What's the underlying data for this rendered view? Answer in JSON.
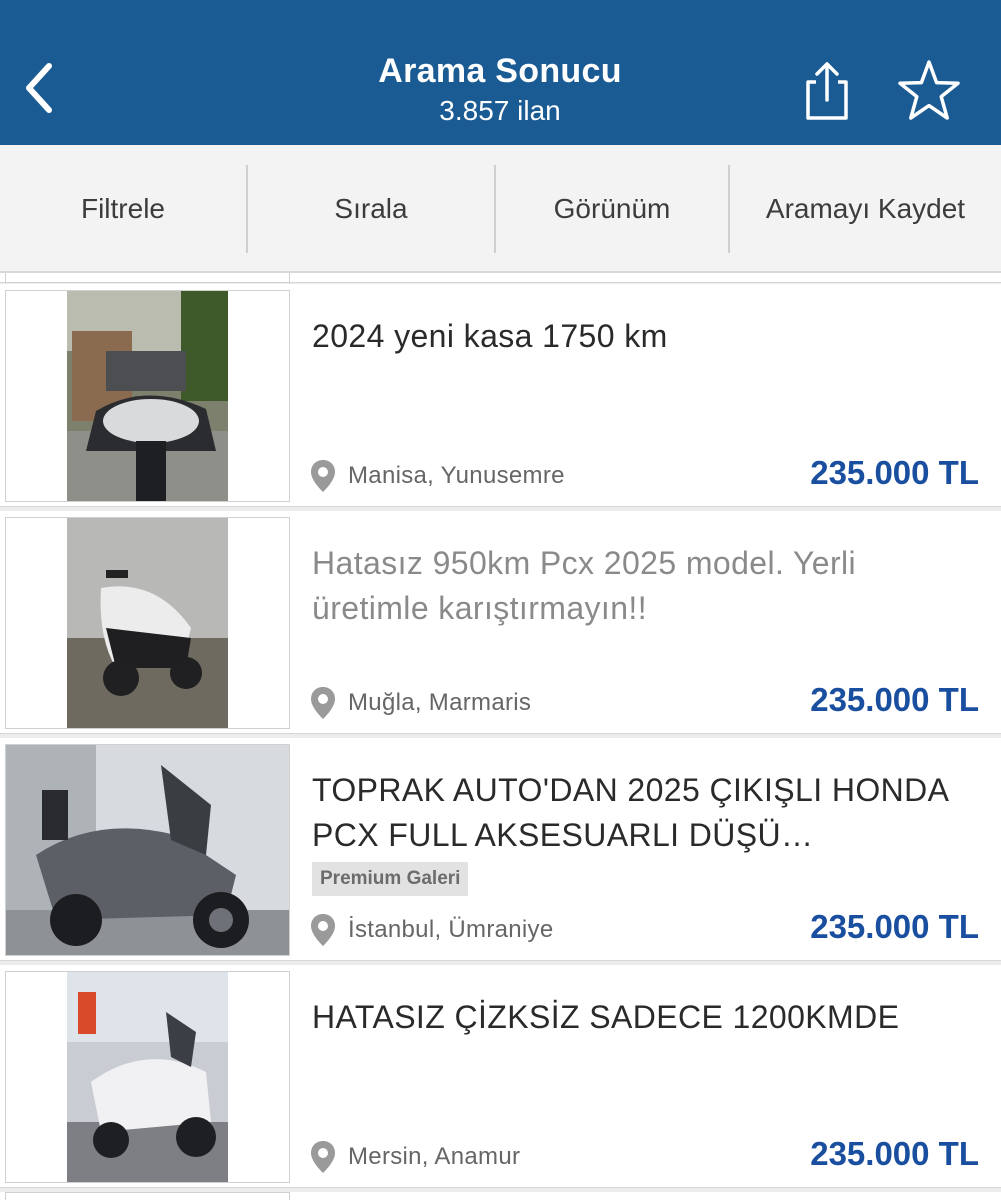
{
  "header": {
    "title": "Arama Sonucu",
    "subtitle": "3.857 ilan"
  },
  "toolbar": {
    "filter": "Filtrele",
    "sort": "Sırala",
    "view": "Görünüm",
    "save_search": "Aramayı Kaydet"
  },
  "listings": [
    {
      "title": "2024 yeni kasa 1750 km",
      "location": "Manisa, Yunusemre",
      "price": "235.000 TL"
    },
    {
      "title": "Hatasız 950km Pcx 2025 model. Yerli üretimle karıştırmayın!!",
      "location": "Muğla, Marmaris",
      "price": "235.000 TL"
    },
    {
      "title": "TOPRAK AUTO'DAN 2025 ÇIKIŞLI HONDA PCX FULL AKSESUARLI DÜŞÜ…",
      "badge": "Premium Galeri",
      "location": "İstanbul, Ümraniye",
      "price": "235.000 TL"
    },
    {
      "title": "HATASIZ ÇİZKSİZ SADECE 1200KMDE",
      "location": "Mersin, Anamur",
      "price": "235.000 TL"
    }
  ],
  "colors": {
    "header": "#1b5b93",
    "price": "#1a4fa0",
    "toolbar_bg": "#f3f3f3"
  },
  "icons": [
    "back-chevron-icon",
    "share-icon",
    "star-icon",
    "location-pin-icon"
  ]
}
